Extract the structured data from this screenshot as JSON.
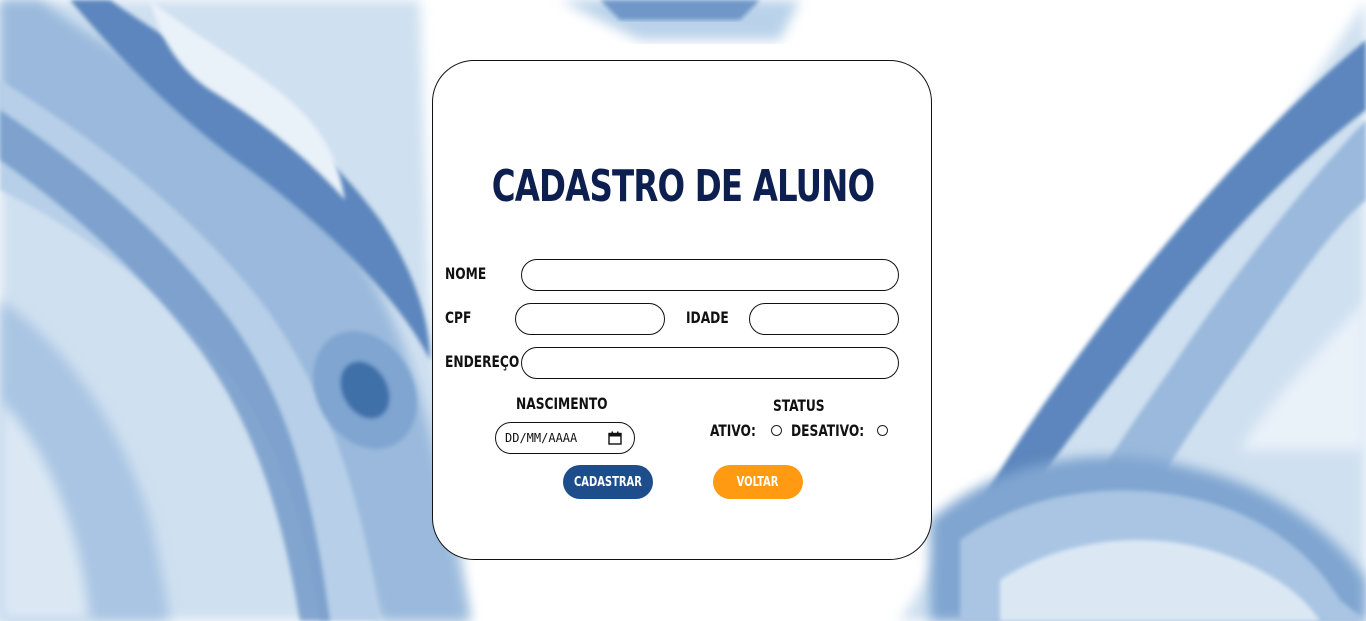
{
  "colors": {
    "title": "#0d1f4f",
    "primary_button": "#1e4d8c",
    "secondary_button": "#ff9a12",
    "background_accent": "#8fb3d9"
  },
  "form": {
    "title": "CADASTRO DE ALUNO",
    "nome_label": "NOME",
    "cpf_label": "CPF",
    "idade_label": "IDADE",
    "endereco_label": "ENDEREÇO",
    "nascimento_label": "NASCIMENTO",
    "nascimento_placeholder": "DD/MM/AAAA",
    "status_label": "STATUS",
    "ativo_label": "ATIVO:",
    "desativo_label": "DESATIVO:",
    "submit_label": "CADASTRAR",
    "back_label": "VOLTAR"
  },
  "icons": {
    "date_picker": "calendar-icon"
  }
}
